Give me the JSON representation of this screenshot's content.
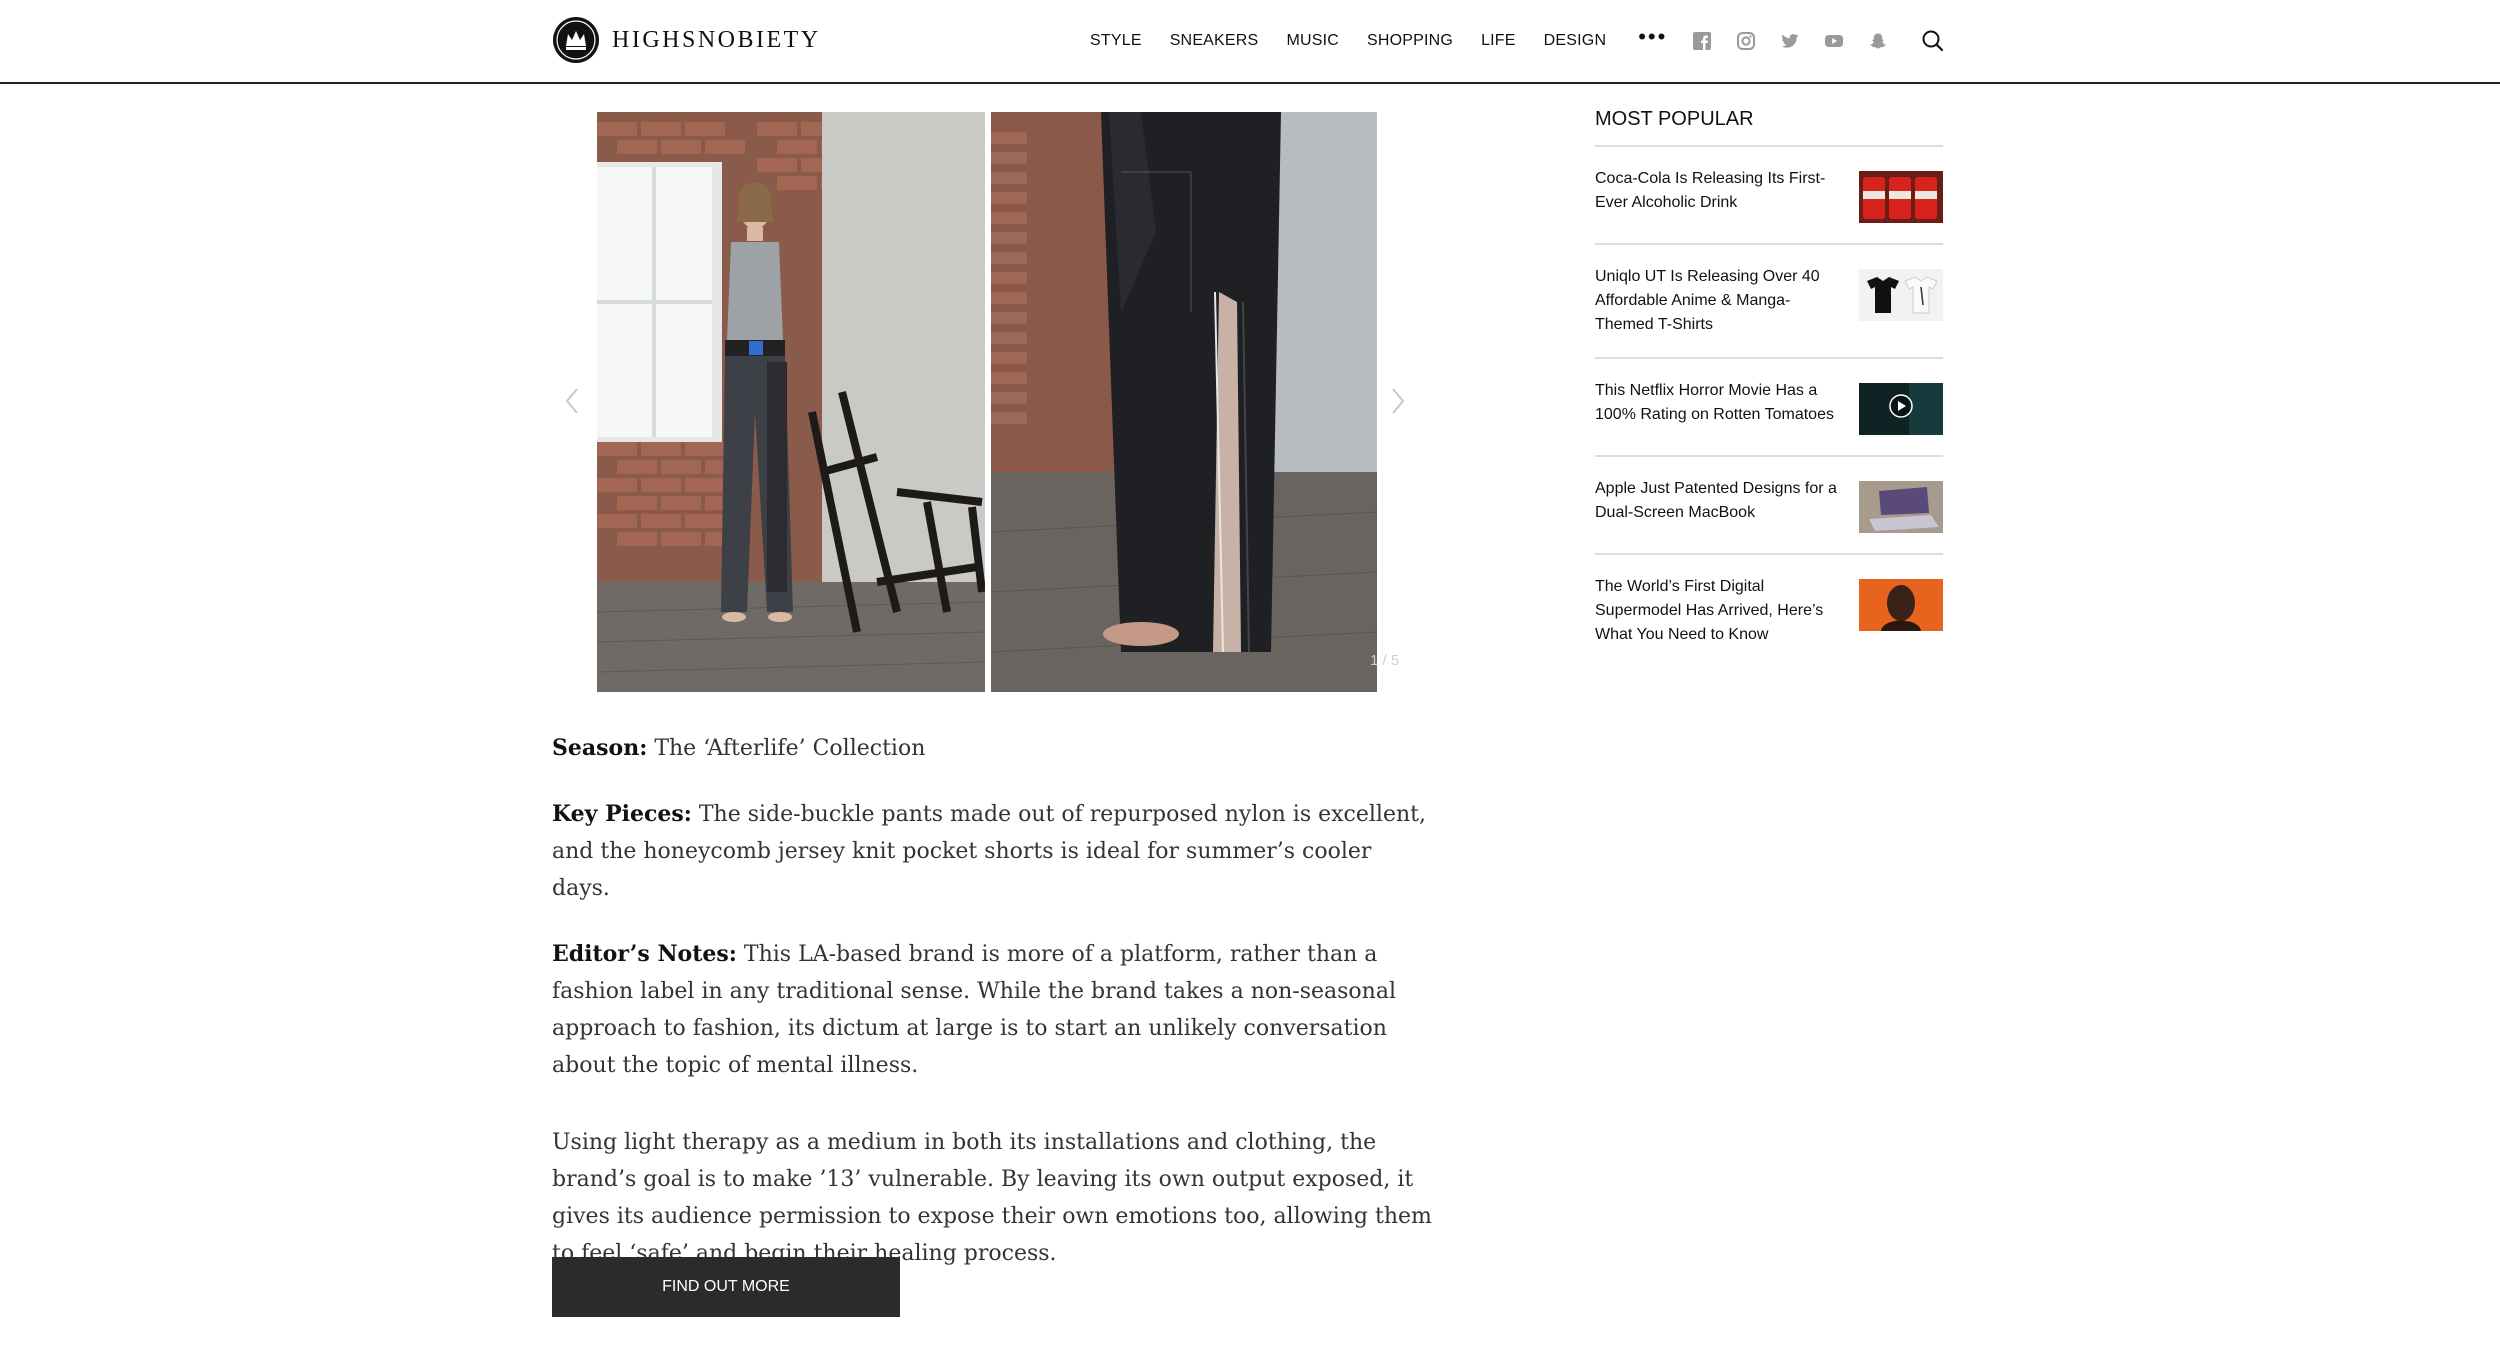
{
  "header": {
    "brand": "HIGHSNOBIETY",
    "nav": [
      {
        "label": "STYLE"
      },
      {
        "label": "SNEAKERS"
      },
      {
        "label": "MUSIC"
      },
      {
        "label": "SHOPPING"
      },
      {
        "label": "LIFE"
      },
      {
        "label": "DESIGN"
      }
    ],
    "more_label": "•••",
    "social_icons": [
      "facebook-icon",
      "instagram-icon",
      "twitter-icon",
      "youtube-icon",
      "snapchat-icon"
    ]
  },
  "gallery": {
    "counter": "1 / 5"
  },
  "article": {
    "season_label": "Season:",
    "season_text": "The ‘Afterlife’ Collection",
    "key_label": "Key Pieces:",
    "key_text": "The side-buckle pants made out of repurposed nylon is excellent, and the honeycomb jersey knit pocket shorts is ideal for summer’s cooler days.",
    "notes_label": "Editor’s Notes:",
    "notes_text": "This LA-based brand is more of a platform, rather than a fashion label in any traditional sense. While the brand takes a non-seasonal approach to fashion, its dictum at large is to start an unlikely conversation about the topic of mental illness.",
    "closing_text": "Using light therapy as a medium in both its installations and clothing, the brand’s goal is to make ’13’ vulnerable. By leaving its own output exposed, it gives its audience permission to expose their own emotions too, allowing them to feel ‘safe’ and begin their healing process.",
    "cta_label": "FIND OUT MORE"
  },
  "sidebar": {
    "title": "MOST POPULAR",
    "items": [
      {
        "title": "Coca-Cola Is Releasing Its First-Ever Alcoholic Drink"
      },
      {
        "title": "Uniqlo UT Is Releasing Over 40 Affordable Anime & Manga-Themed T-Shirts"
      },
      {
        "title": "This Netflix Horror Movie Has a 100% Rating on Rotten Tomatoes"
      },
      {
        "title": "Apple Just Patented Designs for a Dual-Screen MacBook"
      },
      {
        "title": "The World’s First Digital Supermodel Has Arrived, Here’s What You Need to Know"
      }
    ]
  }
}
